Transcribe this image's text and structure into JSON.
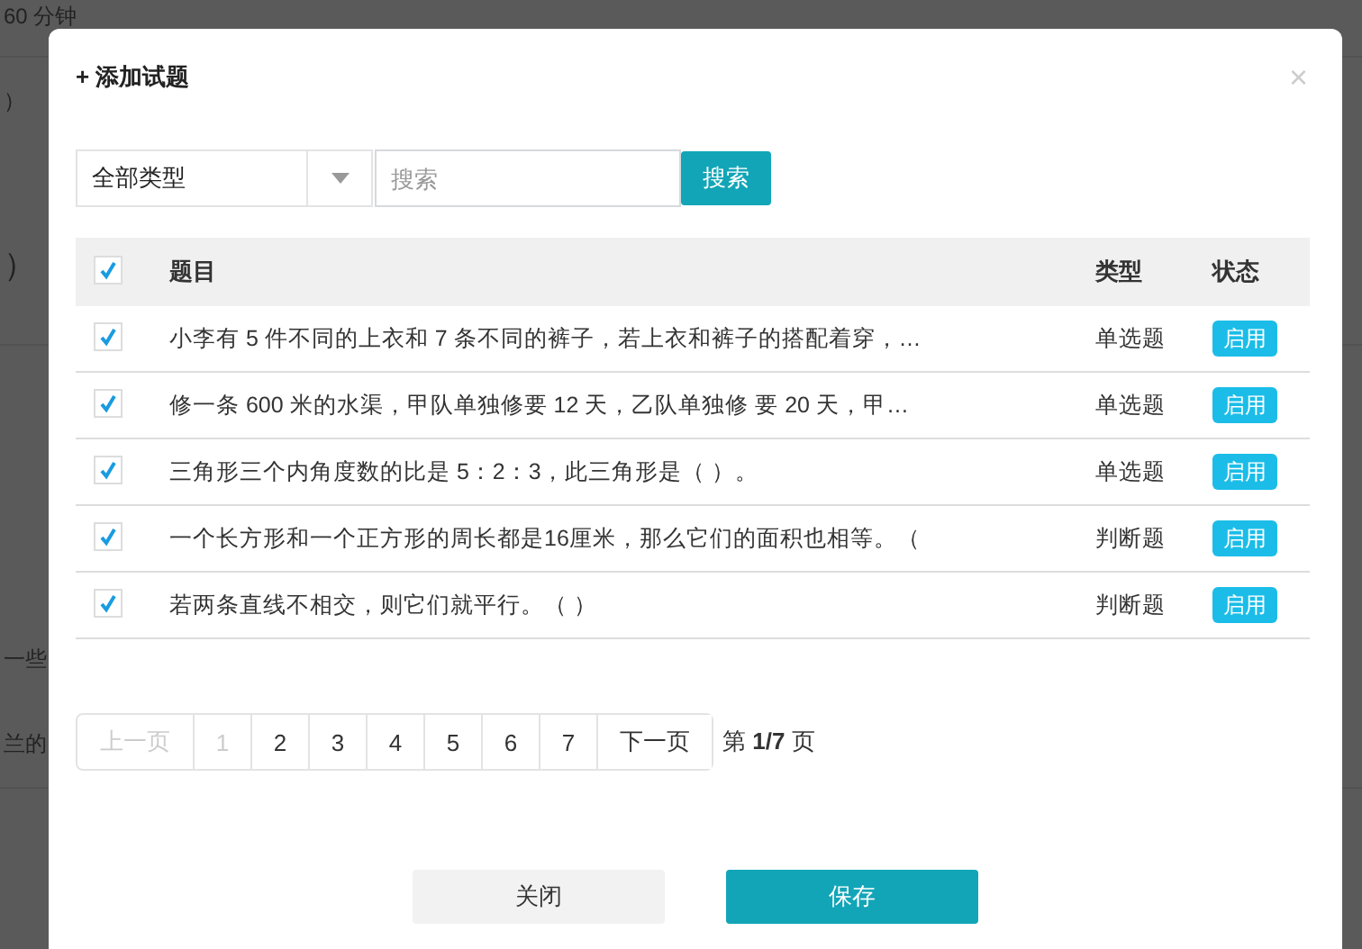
{
  "background": {
    "texts": [
      "60 分钟",
      "）",
      "）",
      "一些",
      "兰的"
    ]
  },
  "dialog": {
    "title": "+ 添加试题",
    "close": "×",
    "filter": {
      "type_select": "全部类型",
      "search": {
        "placeholder": "搜索"
      },
      "search_button": "搜索"
    },
    "table": {
      "header_checked": true,
      "columns": [
        "题目",
        "类型",
        "状态"
      ],
      "rows": [
        {
          "checked": true,
          "title": "小李有 5 件不同的上衣和 7 条不同的裤子，若上衣和裤子的搭配着穿，…",
          "type": "单选题",
          "status": "启用"
        },
        {
          "checked": true,
          "title": "修一条 600 米的水渠，甲队单独修要 12 天，乙队单独修 要 20 天，甲…",
          "type": "单选题",
          "status": "启用"
        },
        {
          "checked": true,
          "title": "三角形三个内角度数的比是 5：2：3，此三角形是（ ）。",
          "type": "单选题",
          "status": "启用"
        },
        {
          "checked": true,
          "title": "一个长方形和一个正方形的周长都是16厘米，那么它们的面积也相等。（",
          "type": "判断题",
          "status": "启用"
        },
        {
          "checked": true,
          "title": "若两条直线不相交，则它们就平行。（ ）",
          "type": "判断题",
          "status": "启用"
        }
      ]
    },
    "pagination": {
      "prev": {
        "label": "上一页",
        "disabled": true
      },
      "pages": [
        {
          "label": "1",
          "selected": true
        },
        {
          "label": "2",
          "selected": false
        },
        {
          "label": "3",
          "selected": false
        },
        {
          "label": "4",
          "selected": false
        },
        {
          "label": "5",
          "selected": false
        },
        {
          "label": "6",
          "selected": false
        },
        {
          "label": "7",
          "selected": false
        }
      ],
      "next": {
        "label": "下一页",
        "disabled": false
      },
      "summary": "第 **1/7** 页"
    },
    "buttons": [
      {
        "label": "关闭",
        "kind": "secondary"
      },
      {
        "label": "保存",
        "kind": "primary"
      }
    ]
  }
}
